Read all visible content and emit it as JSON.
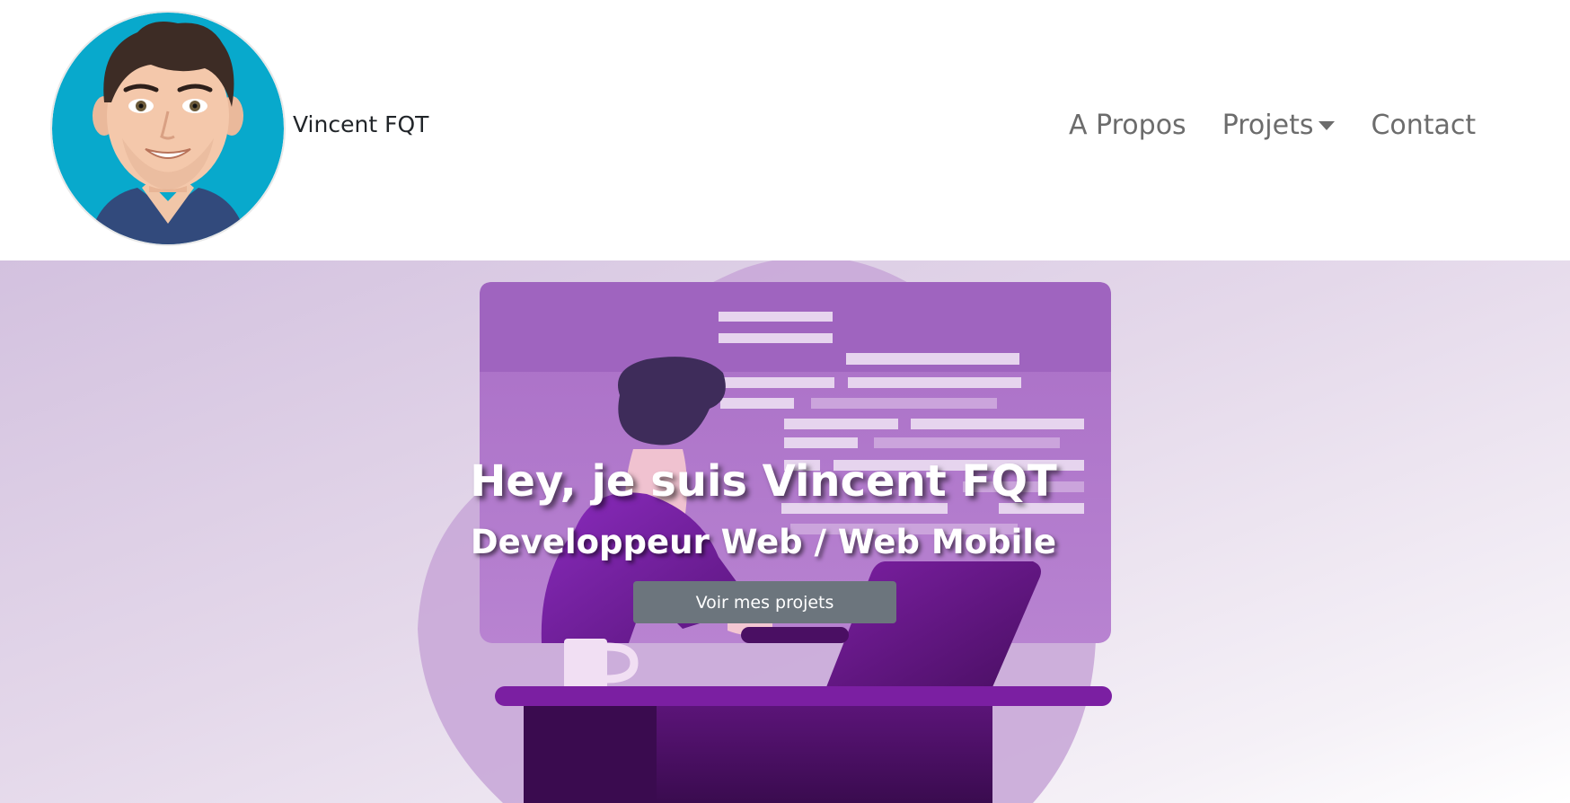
{
  "brand": {
    "name": "Vincent FQT"
  },
  "nav": {
    "items": [
      {
        "label": "A Propos"
      },
      {
        "label": "Projets"
      },
      {
        "label": "Contact"
      }
    ]
  },
  "hero": {
    "title": "Hey, je suis Vincent FQT",
    "subtitle": "Developpeur Web / Web Mobile",
    "cta_label": "Voir mes projets"
  },
  "colors": {
    "nav_link": "#6c6c6c",
    "button_bg": "#6c757d",
    "illustration_purple": "#9f64bf",
    "desk_purple": "#7b1fa2"
  },
  "icons": {
    "dropdown": "caret-down-icon"
  }
}
